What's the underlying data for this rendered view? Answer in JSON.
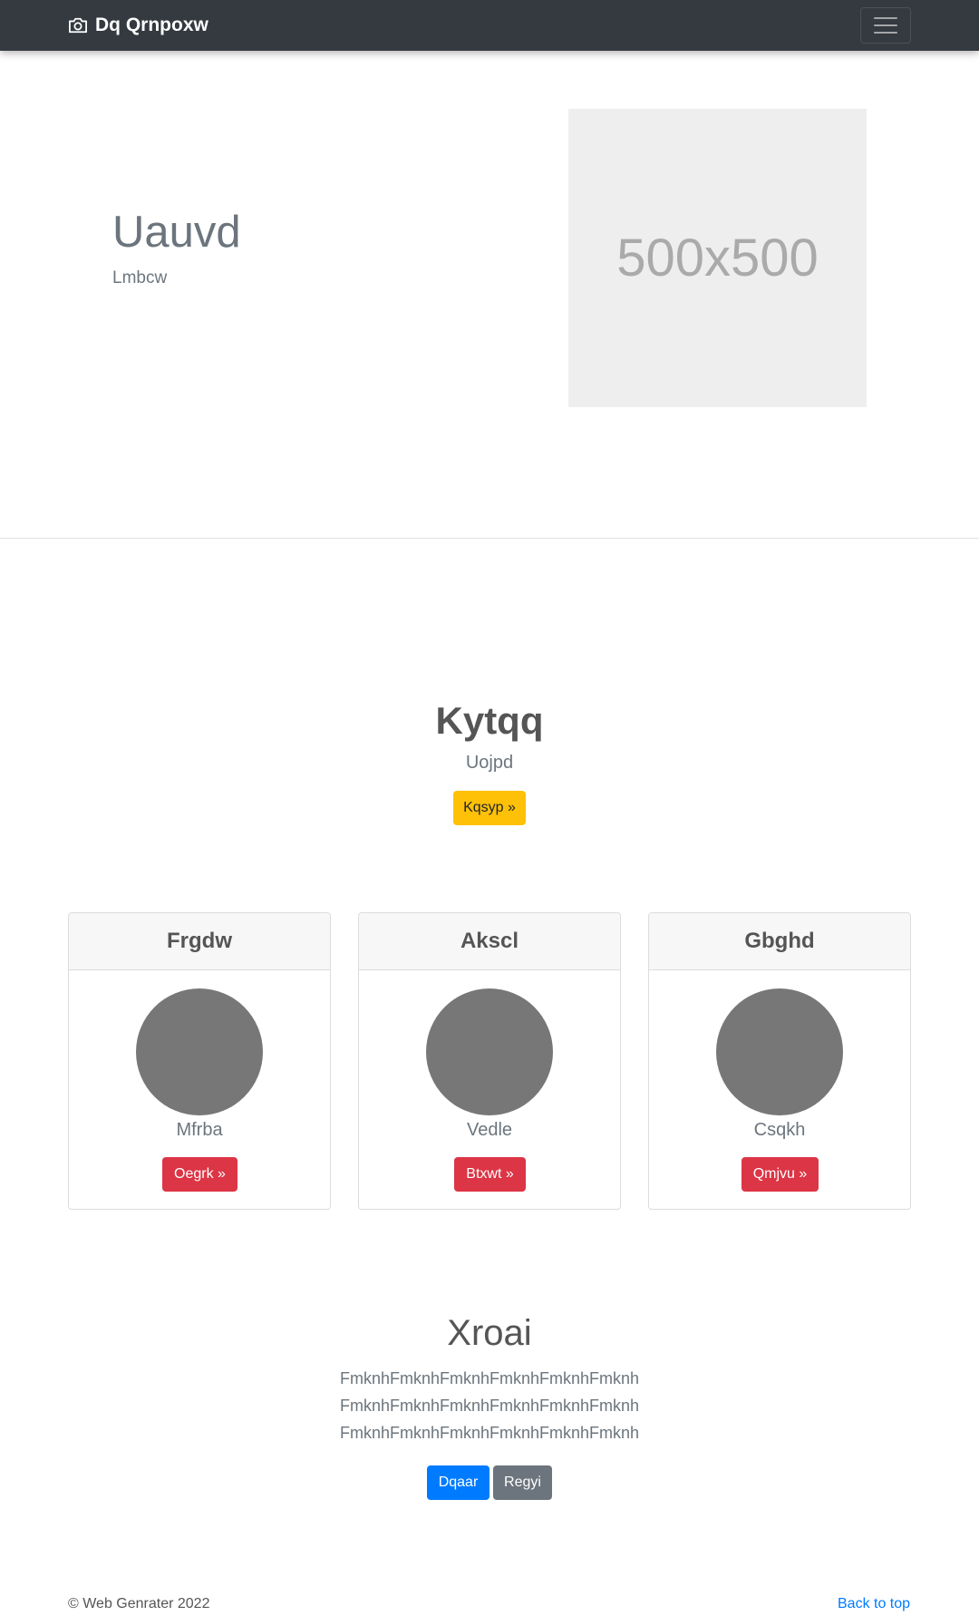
{
  "navbar": {
    "brand": "Dq Qrnpoxw",
    "brand_icon": "camera-icon",
    "toggler_icon": "menu-icon"
  },
  "hero": {
    "title": "Uauvd",
    "subtitle": "Lmbcw",
    "placeholder_text": "500x500"
  },
  "cta": {
    "title": "Kytqq",
    "subtitle": "Uojpd",
    "button": "Kqsyp »"
  },
  "cards": [
    {
      "title": "Frgdw",
      "text": "Mfrba",
      "button": "Oegrk »"
    },
    {
      "title": "Akscl",
      "text": "Vedle",
      "button": "Btxwt »"
    },
    {
      "title": "Gbghd",
      "text": "Csqkh",
      "button": "Qmjvu »"
    }
  ],
  "featurette": {
    "title": "Xroai",
    "lines": [
      "FmknhFmknhFmknhFmknhFmknhFmknh",
      "FmknhFmknhFmknhFmknhFmknhFmknh",
      "FmknhFmknhFmknhFmknhFmknhFmknh"
    ],
    "primary_button": "Dqaar",
    "secondary_button": "Regyi"
  },
  "footer": {
    "copyright": "© Web Genrater 2022",
    "back_to_top": "Back to top"
  },
  "colors": {
    "navbar_bg": "#343a40",
    "warning": "#ffc107",
    "danger": "#dc3545",
    "primary": "#007bff",
    "secondary": "#6c757d"
  }
}
